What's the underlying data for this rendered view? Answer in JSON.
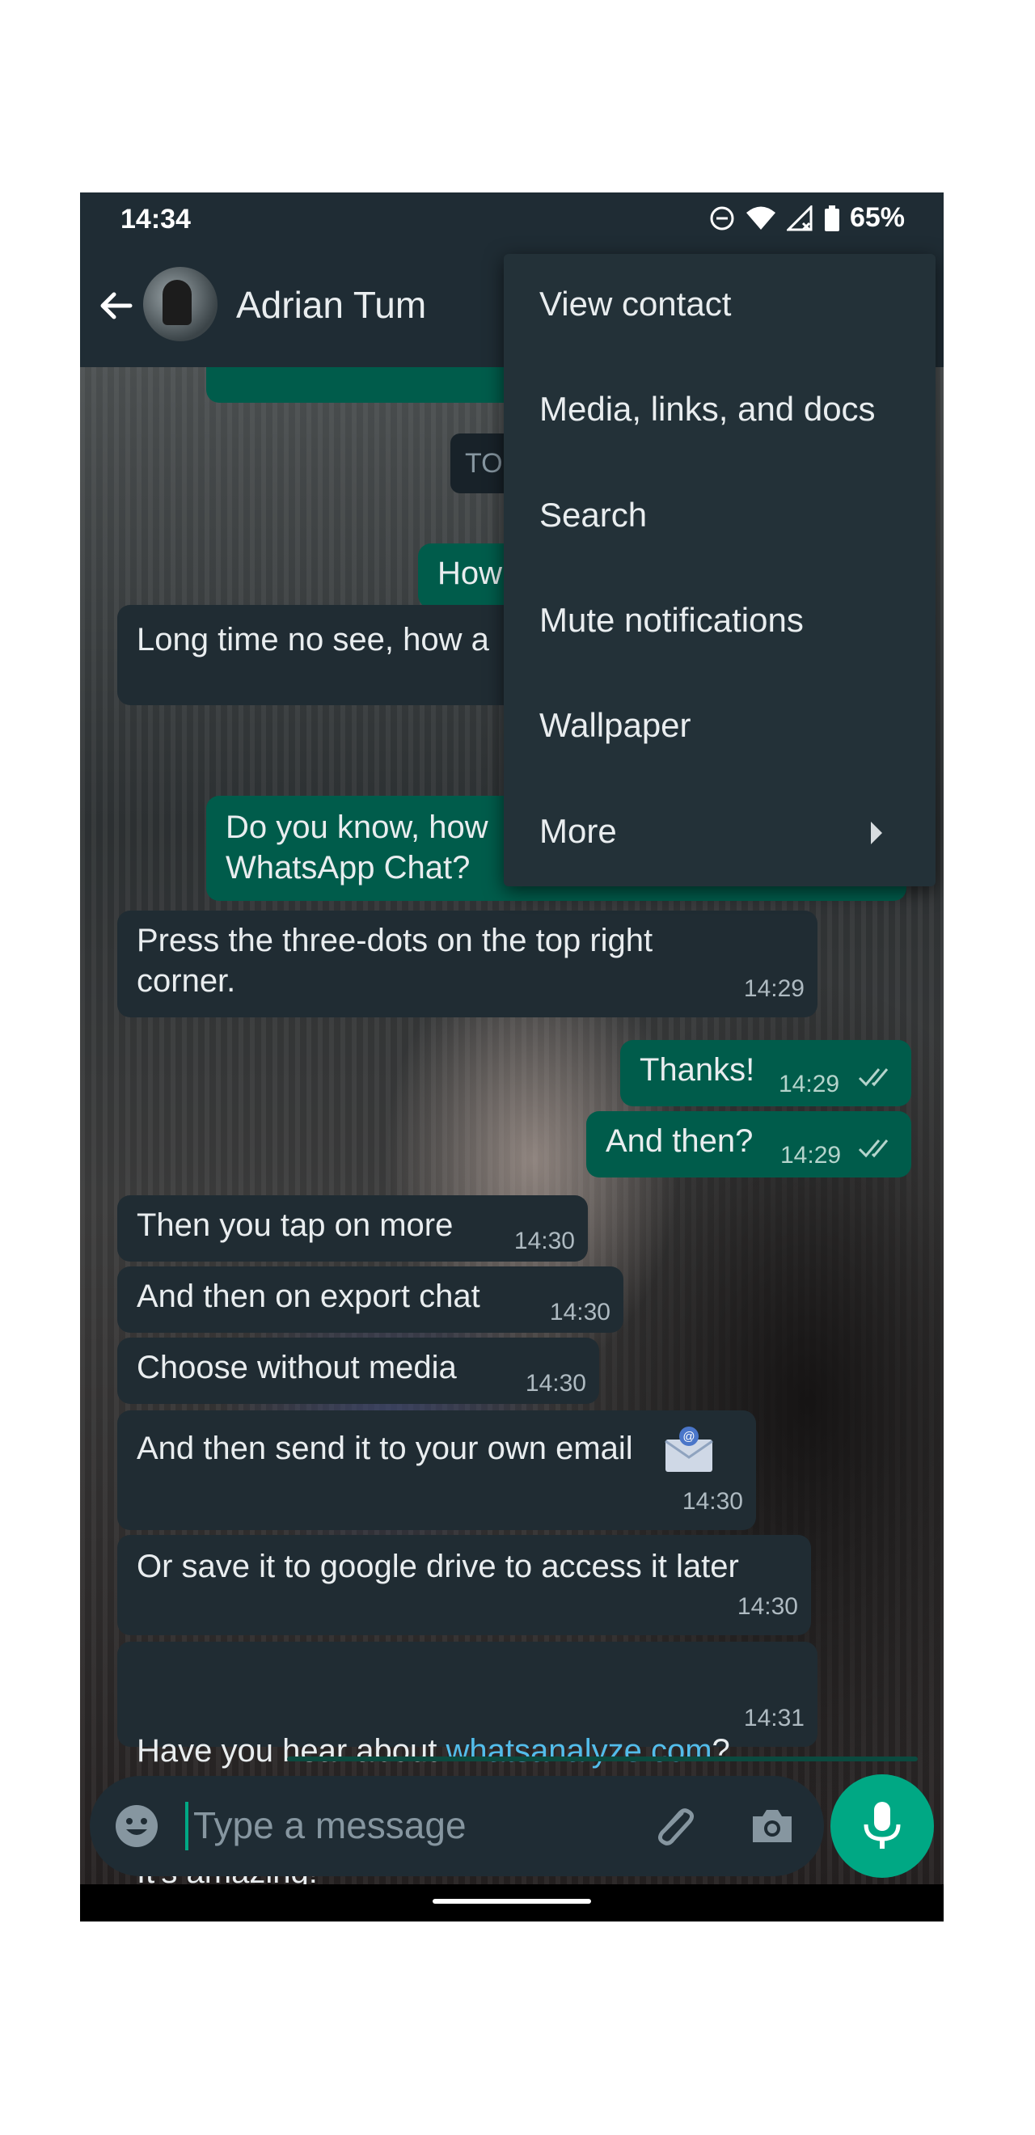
{
  "status_bar": {
    "time": "14:34",
    "battery": "65%"
  },
  "header": {
    "contact_name": "Adrian Tum"
  },
  "date_chip": "TO",
  "menu": {
    "items": [
      {
        "label": "View contact"
      },
      {
        "label": "Media, links, and docs"
      },
      {
        "label": "Search"
      },
      {
        "label": "Mute notifications"
      },
      {
        "label": "Wallpaper"
      },
      {
        "label": "More"
      }
    ]
  },
  "messages": [
    {
      "dir": "out",
      "text": "How",
      "time": ""
    },
    {
      "dir": "in",
      "text": "Long time no see, how a",
      "time": ""
    },
    {
      "dir": "out",
      "text": "Do you know, how\nWhatsApp Chat?",
      "time": ""
    },
    {
      "dir": "in",
      "text": "Press the three-dots on the top right\ncorner.",
      "time": "14:29"
    },
    {
      "dir": "out",
      "text": "Thanks!",
      "time": "14:29"
    },
    {
      "dir": "out",
      "text": "And then?",
      "time": "14:29"
    },
    {
      "dir": "in",
      "text": "Then you tap on more",
      "time": "14:30"
    },
    {
      "dir": "in",
      "text": "And then on export chat",
      "time": "14:30"
    },
    {
      "dir": "in",
      "text": "Choose without media",
      "time": "14:30"
    },
    {
      "dir": "in",
      "text": "And then send it to your own email",
      "time": "14:30"
    },
    {
      "dir": "in",
      "text": "Or save it to google drive to access it later",
      "time": "14:30"
    },
    {
      "dir": "in",
      "text_before": "Have you hear about ",
      "link": "whatsanalyze.com",
      "text_after": "?",
      "text_line2": "It’s amazing!",
      "time": "14:31"
    }
  ],
  "composer": {
    "placeholder": "Type a message"
  },
  "colors": {
    "accent": "#00a884",
    "outgoing": "#005c4b",
    "incoming": "#202c33",
    "link": "#53bdeb"
  },
  "icons": [
    "back-arrow-icon",
    "dnd-icon",
    "wifi-icon",
    "signal-icon",
    "battery-icon",
    "double-check-icon",
    "email-icon",
    "emoji-icon",
    "attach-icon",
    "camera-icon",
    "mic-icon",
    "chevron-right-icon"
  ]
}
